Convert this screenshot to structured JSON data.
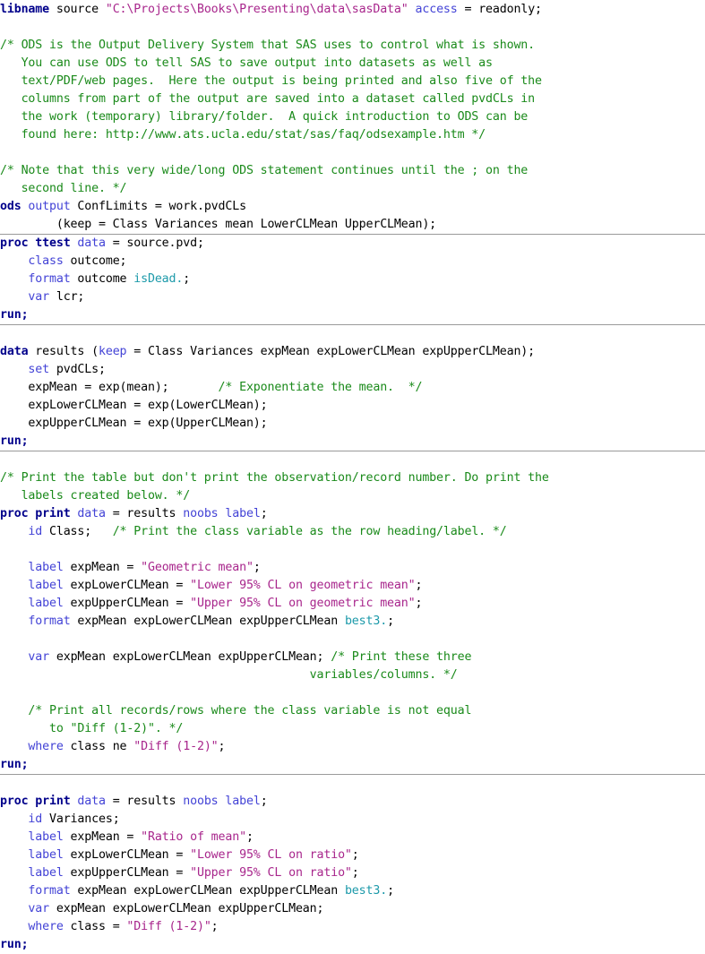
{
  "document": {
    "title": "SAS code listing",
    "language": "SAS",
    "colors": {
      "background": "#ffffff",
      "plain": "#000000",
      "proc_keyword": "#00008b",
      "statement_keyword": "#4343d6",
      "comment": "#1a8a1a",
      "string": "#a8268c",
      "format": "#1d9aaa",
      "separator_rule": "#9a9a9a"
    }
  },
  "blocks": [
    {
      "id": "block-libname",
      "lines": [
        {
          "tokens": [
            {
              "t": "libname ",
              "c": "proc"
            },
            {
              "t": "source ",
              "c": "plain"
            },
            {
              "t": "\"C:\\Projects\\Books\\Presenting\\data\\sasData\"",
              "c": "string"
            },
            {
              "t": " ",
              "c": "plain"
            },
            {
              "t": "access",
              "c": "stmt"
            },
            {
              "t": " = readonly;",
              "c": "plain"
            }
          ]
        },
        {
          "tokens": []
        },
        {
          "tokens": [
            {
              "t": "/* ODS is the Output Delivery System that SAS uses to control what is shown.",
              "c": "comment"
            }
          ]
        },
        {
          "tokens": [
            {
              "t": "   You can use ODS to tell SAS to save output into datasets as well as",
              "c": "comment"
            }
          ]
        },
        {
          "tokens": [
            {
              "t": "   text/PDF/web pages.  Here the output is being printed and also five of the",
              "c": "comment"
            }
          ]
        },
        {
          "tokens": [
            {
              "t": "   columns from part of the output are saved into a dataset called pvdCLs in",
              "c": "comment"
            }
          ]
        },
        {
          "tokens": [
            {
              "t": "   the work (temporary) library/folder.  A quick introduction to ODS can be",
              "c": "comment"
            }
          ]
        },
        {
          "tokens": [
            {
              "t": "   found here: http://www.ats.ucla.edu/stat/sas/faq/odsexample.htm */",
              "c": "comment"
            }
          ]
        },
        {
          "tokens": []
        },
        {
          "tokens": [
            {
              "t": "/* Note that this very wide/long ODS statement continues until the ; on the",
              "c": "comment"
            }
          ]
        },
        {
          "tokens": [
            {
              "t": "   second line. */",
              "c": "comment"
            }
          ]
        },
        {
          "tokens": [
            {
              "t": "ods ",
              "c": "proc"
            },
            {
              "t": "output",
              "c": "stmt"
            },
            {
              "t": " ConfLimits = work.pvdCLs",
              "c": "plain"
            }
          ]
        },
        {
          "tokens": [
            {
              "t": "        (keep = Class Variances mean LowerCLMean UpperCLMean);",
              "c": "plain"
            }
          ]
        }
      ]
    },
    {
      "id": "block-proc-ttest",
      "lines": [
        {
          "tokens": [
            {
              "t": "proc ttest ",
              "c": "proc"
            },
            {
              "t": "data",
              "c": "stmt"
            },
            {
              "t": " = source.pvd;",
              "c": "plain"
            }
          ]
        },
        {
          "tokens": [
            {
              "t": "    class",
              "c": "stmt"
            },
            {
              "t": " outcome;",
              "c": "plain"
            }
          ]
        },
        {
          "tokens": [
            {
              "t": "    format",
              "c": "stmt"
            },
            {
              "t": " outcome ",
              "c": "plain"
            },
            {
              "t": "isDead.",
              "c": "format"
            },
            {
              "t": ";",
              "c": "plain"
            }
          ]
        },
        {
          "tokens": [
            {
              "t": "    var",
              "c": "stmt"
            },
            {
              "t": " lcr;",
              "c": "plain"
            }
          ]
        },
        {
          "tokens": [
            {
              "t": "run;",
              "c": "proc"
            }
          ]
        }
      ]
    },
    {
      "id": "block-data-results",
      "lines": [
        {
          "tokens": []
        },
        {
          "tokens": [
            {
              "t": "data ",
              "c": "proc"
            },
            {
              "t": "results (",
              "c": "plain"
            },
            {
              "t": "keep",
              "c": "stmt"
            },
            {
              "t": " = Class Variances expMean expLowerCLMean expUpperCLMean);",
              "c": "plain"
            }
          ]
        },
        {
          "tokens": [
            {
              "t": "    set",
              "c": "stmt"
            },
            {
              "t": " pvdCLs;",
              "c": "plain"
            }
          ]
        },
        {
          "tokens": [
            {
              "t": "    expMean = exp(mean);       ",
              "c": "plain"
            },
            {
              "t": "/* Exponentiate the mean.  */",
              "c": "comment"
            }
          ]
        },
        {
          "tokens": [
            {
              "t": "    expLowerCLMean = exp(LowerCLMean);",
              "c": "plain"
            }
          ]
        },
        {
          "tokens": [
            {
              "t": "    expUpperCLMean = exp(UpperCLMean);",
              "c": "plain"
            }
          ]
        },
        {
          "tokens": [
            {
              "t": "run;",
              "c": "proc"
            }
          ]
        }
      ]
    },
    {
      "id": "block-proc-print-geometric",
      "lines": [
        {
          "tokens": []
        },
        {
          "tokens": [
            {
              "t": "/* Print the table but don't print the observation/record number. Do print the",
              "c": "comment"
            }
          ]
        },
        {
          "tokens": [
            {
              "t": "   labels created below. */",
              "c": "comment"
            }
          ]
        },
        {
          "tokens": [
            {
              "t": "proc print ",
              "c": "proc"
            },
            {
              "t": "data",
              "c": "stmt"
            },
            {
              "t": " = results ",
              "c": "plain"
            },
            {
              "t": "noobs label",
              "c": "stmt"
            },
            {
              "t": ";",
              "c": "plain"
            }
          ]
        },
        {
          "tokens": [
            {
              "t": "    id",
              "c": "stmt"
            },
            {
              "t": " Class;   ",
              "c": "plain"
            },
            {
              "t": "/* Print the class variable as the row heading/label. */",
              "c": "comment"
            }
          ]
        },
        {
          "tokens": []
        },
        {
          "tokens": [
            {
              "t": "    label",
              "c": "stmt"
            },
            {
              "t": " expMean = ",
              "c": "plain"
            },
            {
              "t": "\"Geometric mean\"",
              "c": "string"
            },
            {
              "t": ";",
              "c": "plain"
            }
          ]
        },
        {
          "tokens": [
            {
              "t": "    label",
              "c": "stmt"
            },
            {
              "t": " expLowerCLMean = ",
              "c": "plain"
            },
            {
              "t": "\"Lower 95% CL on geometric mean\"",
              "c": "string"
            },
            {
              "t": ";",
              "c": "plain"
            }
          ]
        },
        {
          "tokens": [
            {
              "t": "    label",
              "c": "stmt"
            },
            {
              "t": " expUpperCLMean = ",
              "c": "plain"
            },
            {
              "t": "\"Upper 95% CL on geometric mean\"",
              "c": "string"
            },
            {
              "t": ";",
              "c": "plain"
            }
          ]
        },
        {
          "tokens": [
            {
              "t": "    format",
              "c": "stmt"
            },
            {
              "t": " expMean expLowerCLMean expUpperCLMean ",
              "c": "plain"
            },
            {
              "t": "best3.",
              "c": "format"
            },
            {
              "t": ";",
              "c": "plain"
            }
          ]
        },
        {
          "tokens": []
        },
        {
          "tokens": [
            {
              "t": "    var",
              "c": "stmt"
            },
            {
              "t": " expMean expLowerCLMean expUpperCLMean; ",
              "c": "plain"
            },
            {
              "t": "/* Print these three",
              "c": "comment"
            }
          ]
        },
        {
          "tokens": [
            {
              "t": "                                            variables/columns. */",
              "c": "comment"
            }
          ]
        },
        {
          "tokens": []
        },
        {
          "tokens": [
            {
              "t": "    /* Print all records/rows where the class variable is not equal",
              "c": "comment"
            }
          ]
        },
        {
          "tokens": [
            {
              "t": "       to \"Diff (1-2)\". */",
              "c": "comment"
            }
          ]
        },
        {
          "tokens": [
            {
              "t": "    where",
              "c": "stmt"
            },
            {
              "t": " class ne ",
              "c": "plain"
            },
            {
              "t": "\"Diff (1-2)\"",
              "c": "string"
            },
            {
              "t": ";",
              "c": "plain"
            }
          ]
        },
        {
          "tokens": [
            {
              "t": "run;",
              "c": "proc"
            }
          ]
        }
      ]
    },
    {
      "id": "block-proc-print-ratio",
      "last": true,
      "lines": [
        {
          "tokens": []
        },
        {
          "tokens": [
            {
              "t": "proc print ",
              "c": "proc"
            },
            {
              "t": "data",
              "c": "stmt"
            },
            {
              "t": " = results ",
              "c": "plain"
            },
            {
              "t": "noobs label",
              "c": "stmt"
            },
            {
              "t": ";",
              "c": "plain"
            }
          ]
        },
        {
          "tokens": [
            {
              "t": "    id",
              "c": "stmt"
            },
            {
              "t": " Variances;",
              "c": "plain"
            }
          ]
        },
        {
          "tokens": [
            {
              "t": "    label",
              "c": "stmt"
            },
            {
              "t": " expMean = ",
              "c": "plain"
            },
            {
              "t": "\"Ratio of mean\"",
              "c": "string"
            },
            {
              "t": ";",
              "c": "plain"
            }
          ]
        },
        {
          "tokens": [
            {
              "t": "    label",
              "c": "stmt"
            },
            {
              "t": " expLowerCLMean = ",
              "c": "plain"
            },
            {
              "t": "\"Lower 95% CL on ratio\"",
              "c": "string"
            },
            {
              "t": ";",
              "c": "plain"
            }
          ]
        },
        {
          "tokens": [
            {
              "t": "    label",
              "c": "stmt"
            },
            {
              "t": " expUpperCLMean = ",
              "c": "plain"
            },
            {
              "t": "\"Upper 95% CL on ratio\"",
              "c": "string"
            },
            {
              "t": ";",
              "c": "plain"
            }
          ]
        },
        {
          "tokens": [
            {
              "t": "    format",
              "c": "stmt"
            },
            {
              "t": " expMean expLowerCLMean expUpperCLMean ",
              "c": "plain"
            },
            {
              "t": "best3.",
              "c": "format"
            },
            {
              "t": ";",
              "c": "plain"
            }
          ]
        },
        {
          "tokens": [
            {
              "t": "    var",
              "c": "stmt"
            },
            {
              "t": " expMean expLowerCLMean expUpperCLMean;",
              "c": "plain"
            }
          ]
        },
        {
          "tokens": [
            {
              "t": "    where",
              "c": "stmt"
            },
            {
              "t": " class = ",
              "c": "plain"
            },
            {
              "t": "\"Diff (1-2)\"",
              "c": "string"
            },
            {
              "t": ";",
              "c": "plain"
            }
          ]
        },
        {
          "tokens": [
            {
              "t": "run;",
              "c": "proc"
            }
          ]
        }
      ]
    }
  ]
}
